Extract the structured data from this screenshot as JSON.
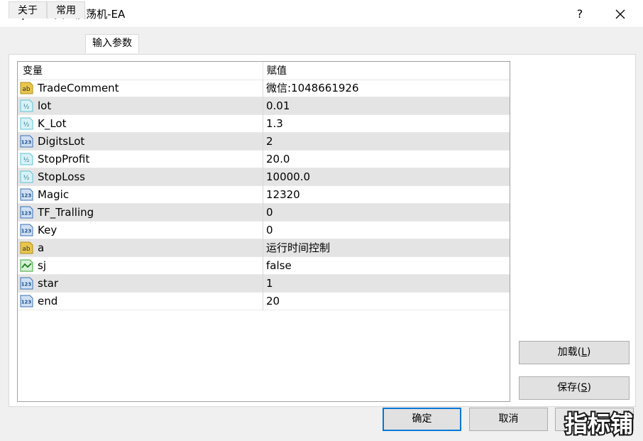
{
  "window": {
    "title": "Expert - 黄金震荡机-EA",
    "help_label": "?"
  },
  "tabs": [
    {
      "label": "关于"
    },
    {
      "label": "常用"
    },
    {
      "label": "输入参数"
    }
  ],
  "grid": {
    "columns": {
      "variable": "变量",
      "value": "赋值"
    },
    "rows": [
      {
        "icon": "string-icon",
        "name": "TradeComment",
        "value": "微信:1048661926"
      },
      {
        "icon": "double-icon",
        "name": "lot",
        "value": "0.01"
      },
      {
        "icon": "double-icon",
        "name": "K_Lot",
        "value": "1.3"
      },
      {
        "icon": "integer-icon",
        "name": "DigitsLot",
        "value": "2"
      },
      {
        "icon": "double-icon",
        "name": "StopProfit",
        "value": "20.0"
      },
      {
        "icon": "double-icon",
        "name": "StopLoss",
        "value": "10000.0"
      },
      {
        "icon": "integer-icon",
        "name": "Magic",
        "value": "12320"
      },
      {
        "icon": "integer-icon",
        "name": "TF_Tralling",
        "value": "0"
      },
      {
        "icon": "integer-icon",
        "name": "Key",
        "value": "0"
      },
      {
        "icon": "string-icon",
        "name": "a",
        "value": "运行时间控制"
      },
      {
        "icon": "bool-icon",
        "name": "sj",
        "value": "false"
      },
      {
        "icon": "integer-icon",
        "name": "star",
        "value": "1"
      },
      {
        "icon": "integer-icon",
        "name": "end",
        "value": "20"
      }
    ]
  },
  "buttons": {
    "load": {
      "text": "加载(",
      "accel": "L",
      "tail": ")"
    },
    "save": {
      "text": "保存(",
      "accel": "S",
      "tail": ")"
    },
    "ok": "确定",
    "cancel": "取消"
  },
  "watermark": "指标铺",
  "colors": {
    "accent": "#0078d7",
    "alt_row": "#e4e4e4",
    "string_icon": "#e8c64a",
    "double_icon": "#5fc3d6",
    "integer_icon": "#3a6fb3",
    "bool_icon": "#3aa03a"
  }
}
